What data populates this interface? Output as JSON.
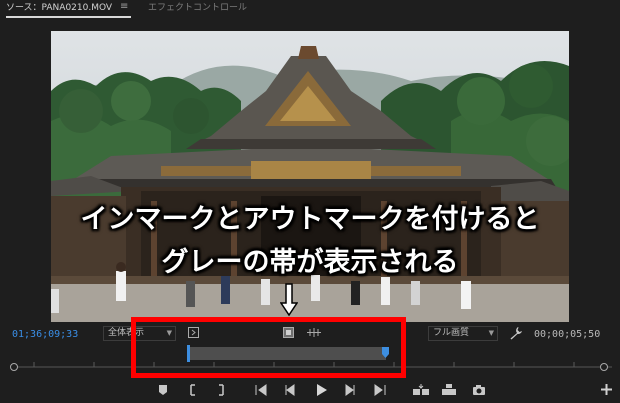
{
  "tabs": {
    "source": "ソース：PANA0210.MOV",
    "menu_glyph": "≡",
    "effect_controls": "エフェクトコントロール"
  },
  "monitor": {
    "timecode_current": "01;36;09;33",
    "timecode_duration": "00;00;05;50",
    "fit_dropdown": "全体表示",
    "quality_dropdown": "フル画質"
  },
  "annotation": {
    "line1": "インマークとアウトマークを付けると",
    "line2": "グレーの帯が表示される",
    "arrow_glyph": "⇩"
  },
  "colors": {
    "accent_blue": "#3a8ee6",
    "highlight_red": "#ff0000",
    "in_out_band": "#4e4e4e"
  },
  "icons": [
    "menu-icon",
    "in-point-icon",
    "out-point-icon",
    "jog-icon",
    "wrench-icon",
    "marker-icon",
    "mark-in-icon",
    "mark-out-icon",
    "go-to-in-icon",
    "step-back-icon",
    "play-icon",
    "step-forward-icon",
    "go-to-out-icon",
    "insert-icon",
    "overwrite-icon",
    "camera-icon",
    "add-icon"
  ]
}
